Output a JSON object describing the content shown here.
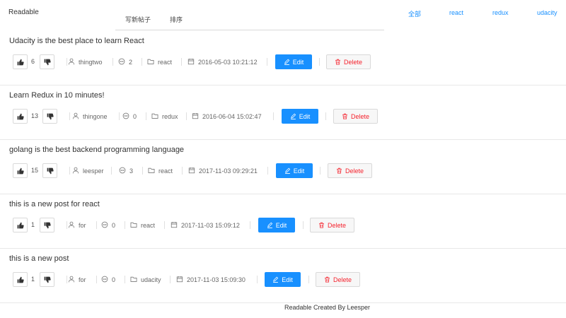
{
  "header": {
    "brand": "Readable",
    "tabs": [
      {
        "label": "写新帖子"
      },
      {
        "label": "排序"
      }
    ],
    "categories": [
      {
        "label": "全部"
      },
      {
        "label": "react"
      },
      {
        "label": "redux"
      },
      {
        "label": "udacity"
      }
    ]
  },
  "posts": [
    {
      "title": "Udacity is the best place to learn React",
      "votes": "6",
      "author": "thingtwo",
      "comments": "2",
      "category": "react",
      "date": "2016-05-03 10:21:12",
      "edit_label": "Edit",
      "delete_label": "Delete"
    },
    {
      "title": "Learn Redux in 10 minutes!",
      "votes": "13",
      "author": "thingone",
      "comments": "0",
      "category": "redux",
      "date": "2016-06-04 15:02:47",
      "edit_label": "Edit",
      "delete_label": "Delete"
    },
    {
      "title": "golang is the best backend programming language",
      "votes": "15",
      "author": "leesper",
      "comments": "3",
      "category": "react",
      "date": "2017-11-03 09:29:21",
      "edit_label": "Edit",
      "delete_label": "Delete"
    },
    {
      "title": "this is a new post for react",
      "votes": "1",
      "author": "for",
      "comments": "0",
      "category": "react",
      "date": "2017-11-03 15:09:12",
      "edit_label": "Edit",
      "delete_label": "Delete"
    },
    {
      "title": "this is a new post",
      "votes": "1",
      "author": "for",
      "comments": "0",
      "category": "udacity",
      "date": "2017-11-03 15:09:30",
      "edit_label": "Edit",
      "delete_label": "Delete"
    }
  ],
  "footer": {
    "text": "Readable Created By Leesper"
  },
  "colors": {
    "primary": "#1890ff",
    "danger": "#f5222d"
  },
  "icons": [
    "like-icon",
    "dislike-icon",
    "user-icon",
    "comment-icon",
    "folder-icon",
    "calendar-icon",
    "edit-icon",
    "delete-icon"
  ]
}
